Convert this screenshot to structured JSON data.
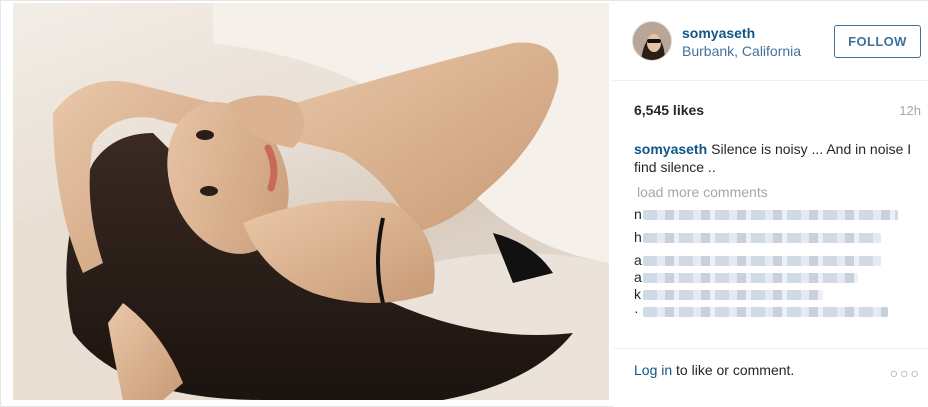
{
  "post": {
    "username": "somyaseth",
    "location": "Burbank, California",
    "follow_label": "FOLLOW",
    "likes": "6,545 likes",
    "time": "12h",
    "caption_user": "somyaseth",
    "caption_text": "Silence is noisy ... And in noise I find silence ..",
    "load_more": "load more comments",
    "comments": [
      {
        "first_char": "n"
      },
      {
        "first_char": "h"
      },
      {
        "first_char": "a"
      },
      {
        "first_char": "a"
      },
      {
        "first_char": "k"
      },
      {
        "first_char": "·"
      }
    ],
    "footer_link": "Log in",
    "footer_text": "to like or comment.",
    "more_icon": "ellipsis-icon",
    "brand_color": "#125688",
    "accent_color": "#3f729b"
  }
}
